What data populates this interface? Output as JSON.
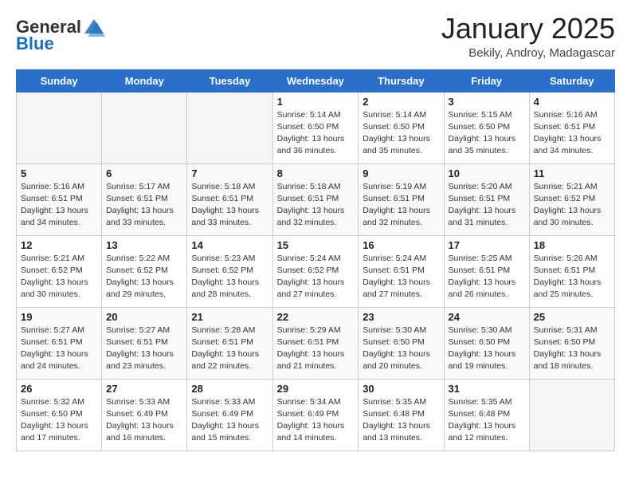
{
  "header": {
    "logo_general": "General",
    "logo_blue": "Blue",
    "month_title": "January 2025",
    "location": "Bekily, Androy, Madagascar"
  },
  "weekdays": [
    "Sunday",
    "Monday",
    "Tuesday",
    "Wednesday",
    "Thursday",
    "Friday",
    "Saturday"
  ],
  "weeks": [
    [
      {
        "day": "",
        "empty": true
      },
      {
        "day": "",
        "empty": true
      },
      {
        "day": "",
        "empty": true
      },
      {
        "day": "1",
        "detail": "Sunrise: 5:14 AM\nSunset: 6:50 PM\nDaylight: 13 hours\nand 36 minutes."
      },
      {
        "day": "2",
        "detail": "Sunrise: 5:14 AM\nSunset: 6:50 PM\nDaylight: 13 hours\nand 35 minutes."
      },
      {
        "day": "3",
        "detail": "Sunrise: 5:15 AM\nSunset: 6:50 PM\nDaylight: 13 hours\nand 35 minutes."
      },
      {
        "day": "4",
        "detail": "Sunrise: 5:16 AM\nSunset: 6:51 PM\nDaylight: 13 hours\nand 34 minutes."
      }
    ],
    [
      {
        "day": "5",
        "detail": "Sunrise: 5:16 AM\nSunset: 6:51 PM\nDaylight: 13 hours\nand 34 minutes."
      },
      {
        "day": "6",
        "detail": "Sunrise: 5:17 AM\nSunset: 6:51 PM\nDaylight: 13 hours\nand 33 minutes."
      },
      {
        "day": "7",
        "detail": "Sunrise: 5:18 AM\nSunset: 6:51 PM\nDaylight: 13 hours\nand 33 minutes."
      },
      {
        "day": "8",
        "detail": "Sunrise: 5:18 AM\nSunset: 6:51 PM\nDaylight: 13 hours\nand 32 minutes."
      },
      {
        "day": "9",
        "detail": "Sunrise: 5:19 AM\nSunset: 6:51 PM\nDaylight: 13 hours\nand 32 minutes."
      },
      {
        "day": "10",
        "detail": "Sunrise: 5:20 AM\nSunset: 6:51 PM\nDaylight: 13 hours\nand 31 minutes."
      },
      {
        "day": "11",
        "detail": "Sunrise: 5:21 AM\nSunset: 6:52 PM\nDaylight: 13 hours\nand 30 minutes."
      }
    ],
    [
      {
        "day": "12",
        "detail": "Sunrise: 5:21 AM\nSunset: 6:52 PM\nDaylight: 13 hours\nand 30 minutes."
      },
      {
        "day": "13",
        "detail": "Sunrise: 5:22 AM\nSunset: 6:52 PM\nDaylight: 13 hours\nand 29 minutes."
      },
      {
        "day": "14",
        "detail": "Sunrise: 5:23 AM\nSunset: 6:52 PM\nDaylight: 13 hours\nand 28 minutes."
      },
      {
        "day": "15",
        "detail": "Sunrise: 5:24 AM\nSunset: 6:52 PM\nDaylight: 13 hours\nand 27 minutes."
      },
      {
        "day": "16",
        "detail": "Sunrise: 5:24 AM\nSunset: 6:51 PM\nDaylight: 13 hours\nand 27 minutes."
      },
      {
        "day": "17",
        "detail": "Sunrise: 5:25 AM\nSunset: 6:51 PM\nDaylight: 13 hours\nand 26 minutes."
      },
      {
        "day": "18",
        "detail": "Sunrise: 5:26 AM\nSunset: 6:51 PM\nDaylight: 13 hours\nand 25 minutes."
      }
    ],
    [
      {
        "day": "19",
        "detail": "Sunrise: 5:27 AM\nSunset: 6:51 PM\nDaylight: 13 hours\nand 24 minutes."
      },
      {
        "day": "20",
        "detail": "Sunrise: 5:27 AM\nSunset: 6:51 PM\nDaylight: 13 hours\nand 23 minutes."
      },
      {
        "day": "21",
        "detail": "Sunrise: 5:28 AM\nSunset: 6:51 PM\nDaylight: 13 hours\nand 22 minutes."
      },
      {
        "day": "22",
        "detail": "Sunrise: 5:29 AM\nSunset: 6:51 PM\nDaylight: 13 hours\nand 21 minutes."
      },
      {
        "day": "23",
        "detail": "Sunrise: 5:30 AM\nSunset: 6:50 PM\nDaylight: 13 hours\nand 20 minutes."
      },
      {
        "day": "24",
        "detail": "Sunrise: 5:30 AM\nSunset: 6:50 PM\nDaylight: 13 hours\nand 19 minutes."
      },
      {
        "day": "25",
        "detail": "Sunrise: 5:31 AM\nSunset: 6:50 PM\nDaylight: 13 hours\nand 18 minutes."
      }
    ],
    [
      {
        "day": "26",
        "detail": "Sunrise: 5:32 AM\nSunset: 6:50 PM\nDaylight: 13 hours\nand 17 minutes."
      },
      {
        "day": "27",
        "detail": "Sunrise: 5:33 AM\nSunset: 6:49 PM\nDaylight: 13 hours\nand 16 minutes."
      },
      {
        "day": "28",
        "detail": "Sunrise: 5:33 AM\nSunset: 6:49 PM\nDaylight: 13 hours\nand 15 minutes."
      },
      {
        "day": "29",
        "detail": "Sunrise: 5:34 AM\nSunset: 6:49 PM\nDaylight: 13 hours\nand 14 minutes."
      },
      {
        "day": "30",
        "detail": "Sunrise: 5:35 AM\nSunset: 6:48 PM\nDaylight: 13 hours\nand 13 minutes."
      },
      {
        "day": "31",
        "detail": "Sunrise: 5:35 AM\nSunset: 6:48 PM\nDaylight: 13 hours\nand 12 minutes."
      },
      {
        "day": "",
        "empty": true
      }
    ]
  ]
}
